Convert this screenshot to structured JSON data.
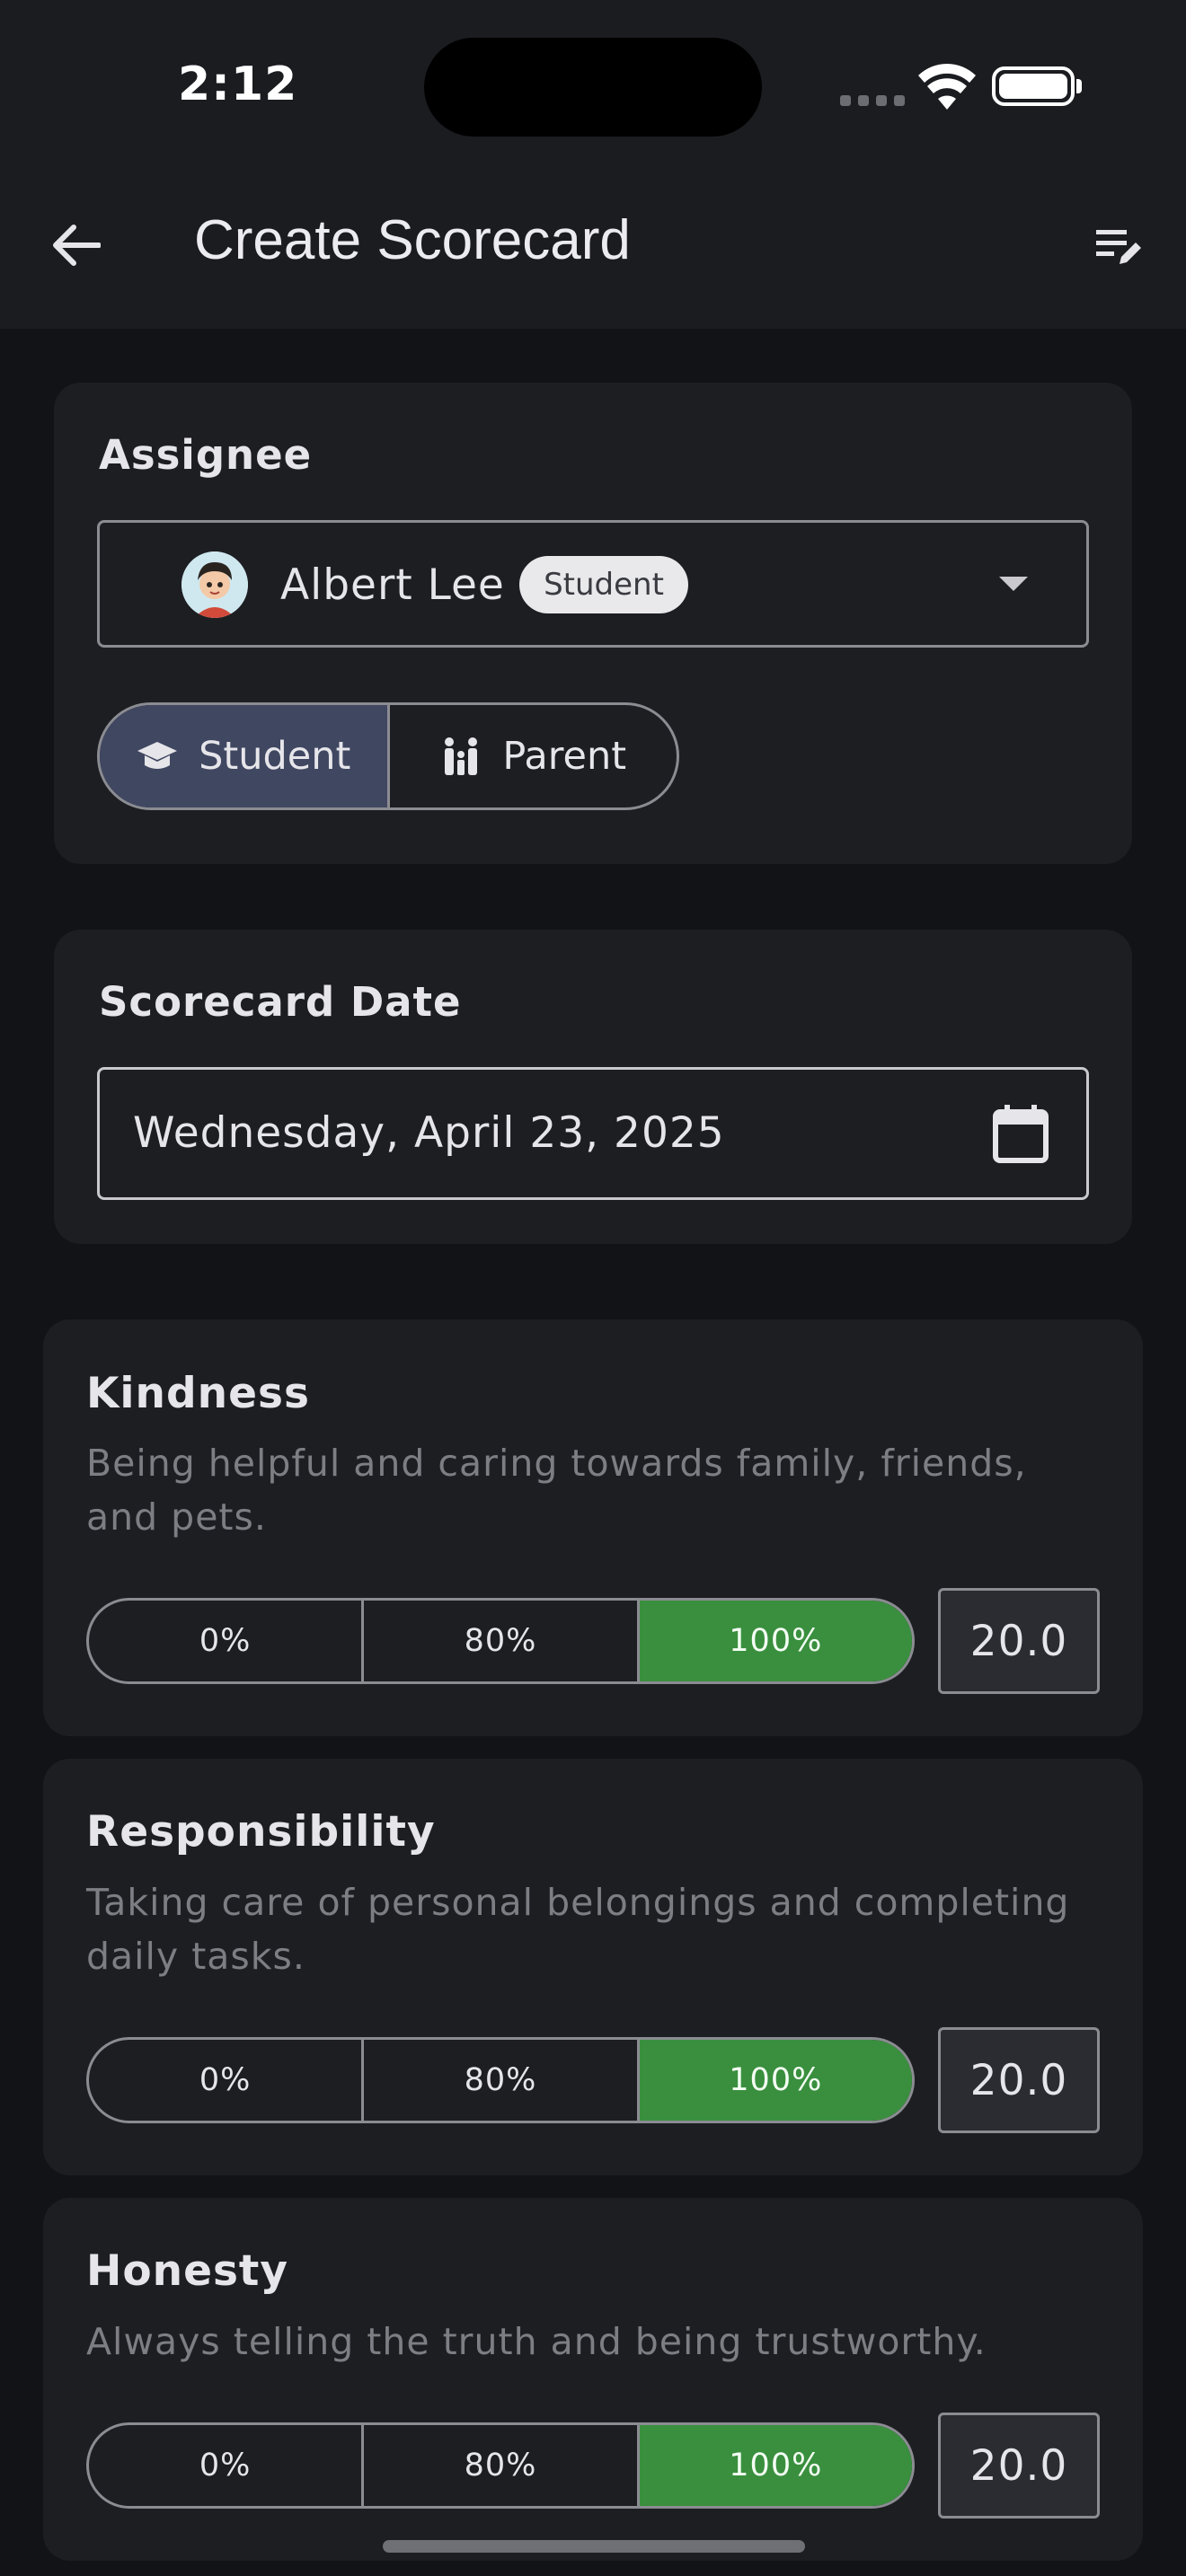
{
  "status_bar": {
    "time": "2:12"
  },
  "app_bar": {
    "title": "Create Scorecard",
    "back_icon": "arrow-left-icon",
    "action_icon": "edit-list-icon"
  },
  "assignee": {
    "label": "Assignee",
    "selected_name": "Albert Lee",
    "selected_role": "Student",
    "toggle": [
      {
        "label": "Student",
        "icon": "graduation-cap-icon",
        "selected": true
      },
      {
        "label": "Parent",
        "icon": "family-icon",
        "selected": false
      }
    ]
  },
  "date": {
    "label": "Scorecard Date",
    "value": "Wednesday, April 23, 2025",
    "icon": "calendar-icon"
  },
  "criteria": [
    {
      "title": "Kindness",
      "description": "Being helpful and caring towards family, friends, and pets.",
      "options": [
        "0%",
        "80%",
        "100%"
      ],
      "selected": "100%",
      "score": "20.0"
    },
    {
      "title": "Responsibility",
      "description": "Taking care of personal belongings and completing daily tasks.",
      "options": [
        "0%",
        "80%",
        "100%"
      ],
      "selected": "100%",
      "score": "20.0"
    },
    {
      "title": "Honesty",
      "description": "Always telling the truth and being trustworthy.",
      "options": [
        "0%",
        "80%",
        "100%"
      ],
      "selected": "100%",
      "score": "20.0"
    }
  ],
  "colors": {
    "selected_option": "#3a8f3e",
    "active_toggle": "#404761",
    "card": "#1d1e22",
    "background": "#121317"
  }
}
